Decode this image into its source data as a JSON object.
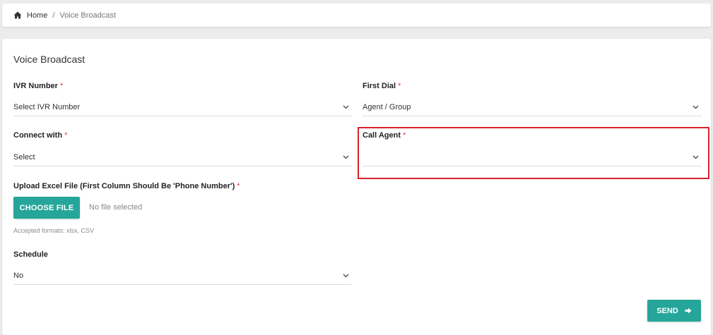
{
  "breadcrumb": {
    "home_icon": "home-icon",
    "home_label": "Home",
    "separator": "/",
    "current": "Voice Broadcast"
  },
  "form": {
    "title": "Voice Broadcast",
    "required_mark": "*",
    "ivr_number": {
      "label": "IVR Number",
      "value": "Select IVR Number"
    },
    "first_dial": {
      "label": "First Dial",
      "value": "Agent / Group"
    },
    "connect_with": {
      "label": "Connect with",
      "value": "Select"
    },
    "call_agent": {
      "label": "Call Agent",
      "value": ""
    },
    "upload": {
      "label": "Upload Excel File (First Column Should Be 'Phone Number')",
      "button_label": "CHOOSE FILE",
      "status": "No file selected",
      "accepted_formats": "Accepted formats: xlsx, CSV"
    },
    "schedule": {
      "label": "Schedule",
      "value": "No"
    },
    "send_label": "SEND",
    "send_icon": "arrow-right-icon"
  },
  "colors": {
    "accent": "#26a69a",
    "required": "#e53935",
    "highlight": "#d9232a"
  }
}
